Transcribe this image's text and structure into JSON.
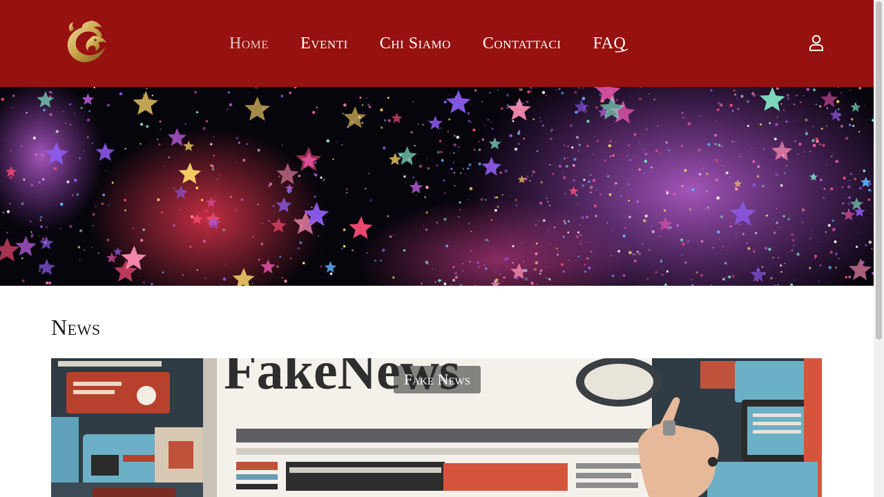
{
  "nav": {
    "items": [
      {
        "label": "Home",
        "active": true
      },
      {
        "label": "Eventi"
      },
      {
        "label": "Chi Siamo"
      },
      {
        "label": "Contattaci"
      },
      {
        "label": "FAQ"
      }
    ],
    "user_icon": "user-icon",
    "logo_icon": "dragon-logo-icon"
  },
  "news": {
    "title": "News",
    "card": {
      "badge": "Fake News",
      "image_text": "FakeNews"
    }
  },
  "colors": {
    "header_bg": "#96110f",
    "active_nav": "#e6c7c6",
    "nav_text": "#ffffff",
    "hero_bg": "#07050c"
  }
}
